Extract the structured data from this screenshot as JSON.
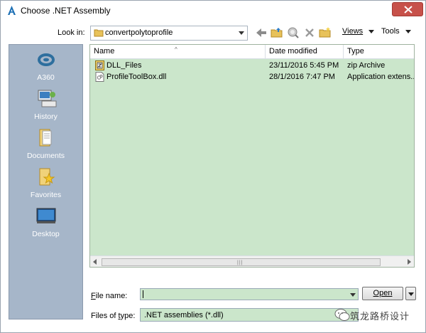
{
  "window": {
    "title": "Choose .NET Assembly"
  },
  "toolbar": {
    "look_in_label": "Look in:",
    "look_in_value": "convertpolytoprofile",
    "views_label": "Views",
    "tools_label": "Tools"
  },
  "places": [
    {
      "label": "A360",
      "icon": "a360-icon"
    },
    {
      "label": "History",
      "icon": "history-icon"
    },
    {
      "label": "Documents",
      "icon": "documents-icon"
    },
    {
      "label": "Favorites",
      "icon": "favorites-icon"
    },
    {
      "label": "Desktop",
      "icon": "desktop-icon"
    }
  ],
  "file_list": {
    "columns": [
      "Name",
      "Date modified",
      "Type"
    ],
    "rows": [
      {
        "name": "DLL_Files",
        "date": "23/11/2016 5:45 PM",
        "type": "zip Archive",
        "icon": "zip-file-icon"
      },
      {
        "name": "ProfileToolBox.dll",
        "date": "28/1/2016 7:47 PM",
        "type": "Application extens...",
        "icon": "dll-file-icon"
      }
    ]
  },
  "footer": {
    "file_name_label": "File name:",
    "file_name_value": "",
    "open_label": "Open",
    "file_type_label": "Files of type:",
    "file_type_value": ".NET assemblies (*.dll)"
  },
  "watermark": {
    "text": "筑龙路桥设计"
  },
  "colors": {
    "selection_green": "#cbe6cb",
    "places_bg": "#a6b6c9",
    "close_red": "#c7514a"
  }
}
